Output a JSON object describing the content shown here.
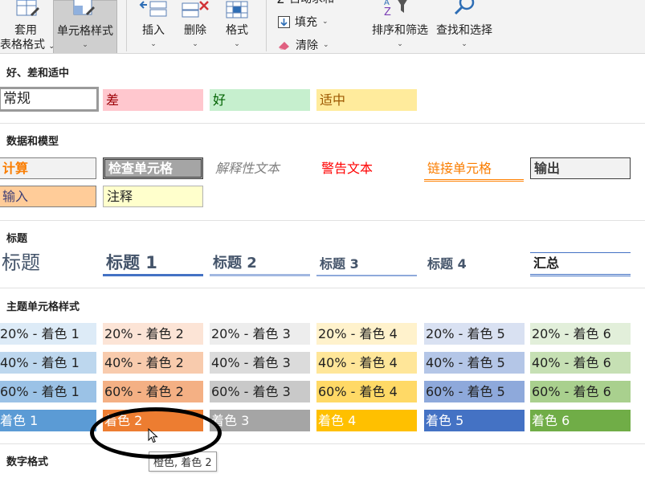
{
  "ribbon": {
    "table_format": {
      "line1": "套用",
      "line2": "表格格式"
    },
    "cell_styles": {
      "line1": "单元格样式"
    },
    "insert": {
      "label": "插入"
    },
    "delete": {
      "label": "删除"
    },
    "format": {
      "label": "格式"
    },
    "autosum": {
      "label": "自动求和"
    },
    "fill": {
      "label": "填充"
    },
    "clear": {
      "label": "清除"
    },
    "sort_filter": {
      "label": "排序和筛选"
    },
    "find_select": {
      "label": "查找和选择"
    }
  },
  "sections": {
    "good_bad": "好、差和适中",
    "data_model": "数据和模型",
    "titles": "标题",
    "themed": "主题单元格样式",
    "number_format": "数字格式"
  },
  "good_bad": [
    "常规",
    "差",
    "好",
    "适中"
  ],
  "data_model": {
    "row1": [
      "计算",
      "检查单元格",
      "解释性文本",
      "警告文本",
      "链接单元格",
      "输出"
    ],
    "row2": [
      "输入",
      "注释"
    ]
  },
  "titles": [
    "标题",
    "标题 1",
    "标题 2",
    "标题 3",
    "标题 4",
    "汇总"
  ],
  "themed": {
    "row20": [
      "20% - 着色 1",
      "20% - 着色 2",
      "20% - 着色 3",
      "20% - 着色 4",
      "20% - 着色 5",
      "20% - 着色 6"
    ],
    "row40": [
      "40% - 着色 1",
      "40% - 着色 2",
      "40% - 着色 3",
      "40% - 着色 4",
      "40% - 着色 5",
      "40% - 着色 6"
    ],
    "row60": [
      "60% - 着色 1",
      "60% - 着色 2",
      "60% - 着色 3",
      "60% - 着色 4",
      "60% - 着色 5",
      "60% - 着色 6"
    ],
    "row100": [
      "着色 1",
      "着色 2",
      "着色 3",
      "着色 4",
      "着色 5",
      "着色 6"
    ]
  },
  "tooltip": "橙色, 着色 2",
  "colors": {
    "accent1": "#5b9bd5",
    "accent2": "#ed7d31",
    "accent3": "#a5a5a5",
    "accent4": "#ffc000",
    "accent5": "#4472c4",
    "accent6": "#70ad47",
    "bad_fill": "#ffc7ce",
    "good_fill": "#c6efce",
    "neutral_fill": "#ffeb9c"
  }
}
